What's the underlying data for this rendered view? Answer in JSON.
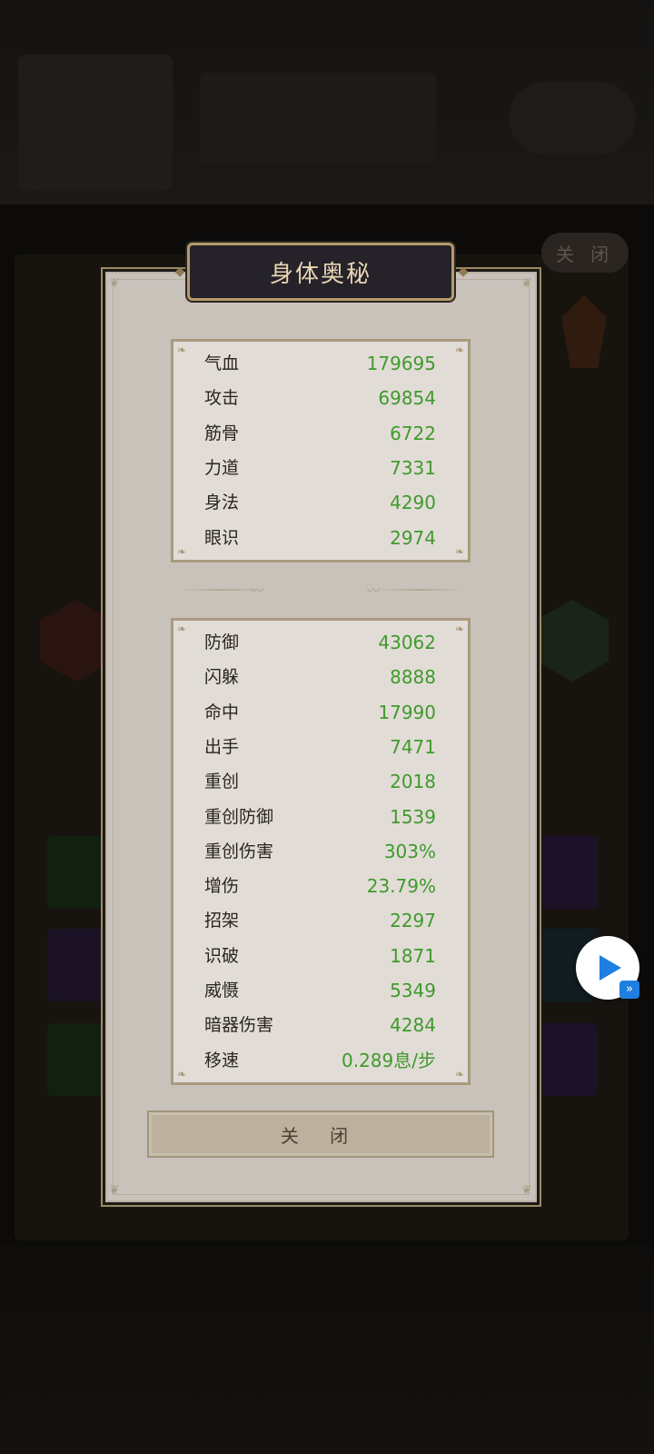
{
  "background": {
    "close_label": "关 闭"
  },
  "dialog": {
    "title": "身体奥秘",
    "close_label": "关 闭"
  },
  "primary_stats": [
    {
      "label": "气血",
      "value": "179695"
    },
    {
      "label": "攻击",
      "value": "69854"
    },
    {
      "label": "筋骨",
      "value": "6722"
    },
    {
      "label": "力道",
      "value": "7331"
    },
    {
      "label": "身法",
      "value": "4290"
    },
    {
      "label": "眼识",
      "value": "2974"
    }
  ],
  "secondary_stats": [
    {
      "label": "防御",
      "value": "43062"
    },
    {
      "label": "闪躲",
      "value": "8888"
    },
    {
      "label": "命中",
      "value": "17990"
    },
    {
      "label": "出手",
      "value": "7471"
    },
    {
      "label": "重创",
      "value": "2018"
    },
    {
      "label": "重创防御",
      "value": "1539"
    },
    {
      "label": "重创伤害",
      "value": "303%"
    },
    {
      "label": "增伤",
      "value": "23.79%"
    },
    {
      "label": "招架",
      "value": "2297"
    },
    {
      "label": "识破",
      "value": "1871"
    },
    {
      "label": "威慑",
      "value": "5349"
    },
    {
      "label": "暗器伤害",
      "value": "4284"
    },
    {
      "label": "移速",
      "value": "0.289息/步"
    }
  ],
  "colors": {
    "value_green": "#3f9a2c",
    "panel_bg": "#c9c2bb",
    "title_text": "#e7d6b3"
  },
  "floating": {
    "play_icon": "play-icon",
    "fast_forward_icon": "fast-forward-icon"
  }
}
